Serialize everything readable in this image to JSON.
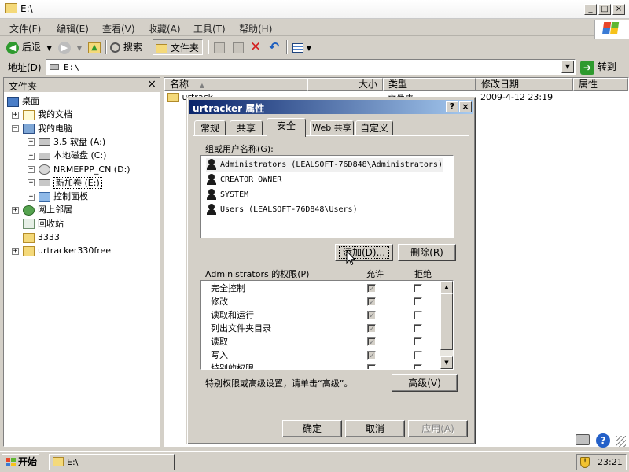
{
  "window": {
    "title": "E:\\",
    "controls": {
      "minimize": "_",
      "maximize": "□",
      "close": "×"
    }
  },
  "menu": [
    "文件(F)",
    "编辑(E)",
    "查看(V)",
    "收藏(A)",
    "工具(T)",
    "帮助(H)"
  ],
  "toolbar": {
    "back": "后退",
    "search": "搜索",
    "folders": "文件夹"
  },
  "address": {
    "label": "地址(D)",
    "value": "E:\\",
    "go": "转到"
  },
  "folder_pane": {
    "title": "文件夹",
    "close": "×",
    "items": [
      {
        "label": "桌面",
        "level": 0,
        "expander": "",
        "icon": "desktop-icon"
      },
      {
        "label": "我的文档",
        "level": 1,
        "expander": "+",
        "icon": "documents-icon"
      },
      {
        "label": "我的电脑",
        "level": 1,
        "expander": "−",
        "icon": "computer-icon"
      },
      {
        "label": "3.5 软盘 (A:)",
        "level": 2,
        "expander": "+",
        "icon": "floppy-icon"
      },
      {
        "label": "本地磁盘 (C:)",
        "level": 2,
        "expander": "+",
        "icon": "drive-icon"
      },
      {
        "label": "NRMEFPP_CN (D:)",
        "level": 2,
        "expander": "+",
        "icon": "cd-icon"
      },
      {
        "label": "新加卷 (E:)",
        "level": 2,
        "expander": "+",
        "icon": "drive-icon"
      },
      {
        "label": "控制面板",
        "level": 2,
        "expander": "+",
        "icon": "control-panel-icon"
      },
      {
        "label": "网上邻居",
        "level": 1,
        "expander": "+",
        "icon": "network-icon"
      },
      {
        "label": "回收站",
        "level": 1,
        "expander": "",
        "icon": "recycle-bin-icon"
      },
      {
        "label": "3333",
        "level": 1,
        "expander": "",
        "icon": "folder-icon"
      },
      {
        "label": "urtracker330free",
        "level": 1,
        "expander": "+",
        "icon": "folder-icon"
      }
    ]
  },
  "list": {
    "columns": [
      "名称",
      "大小",
      "类型",
      "修改日期",
      "属性"
    ],
    "rows": [
      {
        "name": "urtrack",
        "size": "",
        "type": "文件夹",
        "date": "2009-4-12 23:19",
        "attr": ""
      }
    ]
  },
  "dialog": {
    "title": "urtracker 属性",
    "help": "?",
    "close": "×",
    "tabs": [
      "常规",
      "共享",
      "安全",
      "Web 共享",
      "自定义"
    ],
    "active_tab": 2,
    "group_label": "组或用户名称(G):",
    "users": [
      "Administrators (LEALSOFT-76D848\\Administrators)",
      "CREATOR OWNER",
      "SYSTEM",
      "Users (LEALSOFT-76D848\\Users)"
    ],
    "add_button": "添加(D)...",
    "remove_button": "删除(R)",
    "perm_label": "Administrators 的权限(P)",
    "allow_label": "允许",
    "deny_label": "拒绝",
    "permissions": [
      {
        "name": "完全控制",
        "allow": true,
        "deny": false
      },
      {
        "name": "修改",
        "allow": true,
        "deny": false
      },
      {
        "name": "读取和运行",
        "allow": true,
        "deny": false
      },
      {
        "name": "列出文件夹目录",
        "allow": true,
        "deny": false
      },
      {
        "name": "读取",
        "allow": true,
        "deny": false
      },
      {
        "name": "写入",
        "allow": true,
        "deny": false
      },
      {
        "name": "特别的权限",
        "allow": false,
        "deny": false
      }
    ],
    "advanced_hint": "特别权限或高级设置，请单击“高级”。",
    "advanced_button": "高级(V)",
    "ok": "确定",
    "cancel": "取消",
    "apply": "应用(A)"
  },
  "taskbar": {
    "start": "开始",
    "task": "E:\\",
    "time": "23:21"
  },
  "colors": {
    "titlebar_active": "#0a246a",
    "face": "#d4d0c8",
    "folder": "#f4d97a"
  }
}
